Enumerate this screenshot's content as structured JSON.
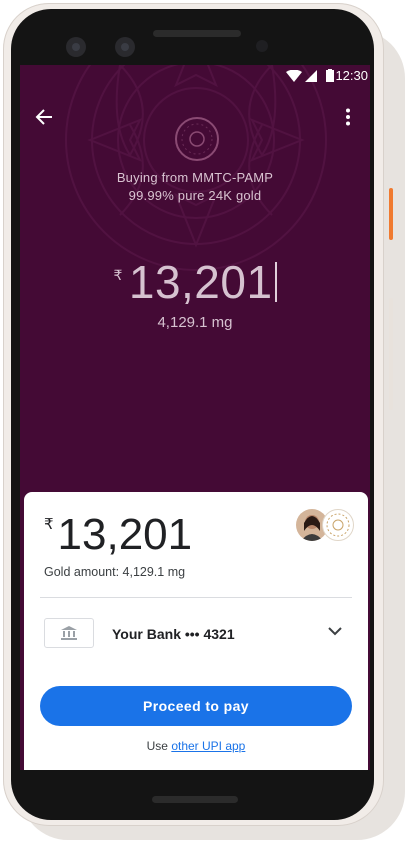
{
  "status_bar": {
    "time": "12:30",
    "icons": [
      "wifi-icon",
      "signal-icon",
      "battery-icon"
    ]
  },
  "appbar": {
    "back_icon": "arrow-back-icon",
    "menu_icon": "more-vert-icon"
  },
  "merchant": {
    "logo_text": "MMTC-PAMP",
    "buying_from": "Buying from MMTC-PAMP",
    "purity": "99.99% pure 24K gold"
  },
  "entry": {
    "currency": "₹",
    "amount": "13,201",
    "grams": "4,129.1 mg"
  },
  "sheet": {
    "currency": "₹",
    "amount": "13,201",
    "gold_amount": "Gold amount: 4,129.1 mg",
    "bank_icon": "bank-icon",
    "bank_label": "Your Bank ••• 4321",
    "pay_button": "Proceed to pay",
    "use_prefix": "Use ",
    "use_link": "other UPI app"
  },
  "colors": {
    "screen_bg": "#440a35",
    "button_blue": "#1a73e8",
    "link_blue": "#1a73e8",
    "sheet_bg": "#ffffff",
    "accent_orange": "#f07a2f"
  }
}
